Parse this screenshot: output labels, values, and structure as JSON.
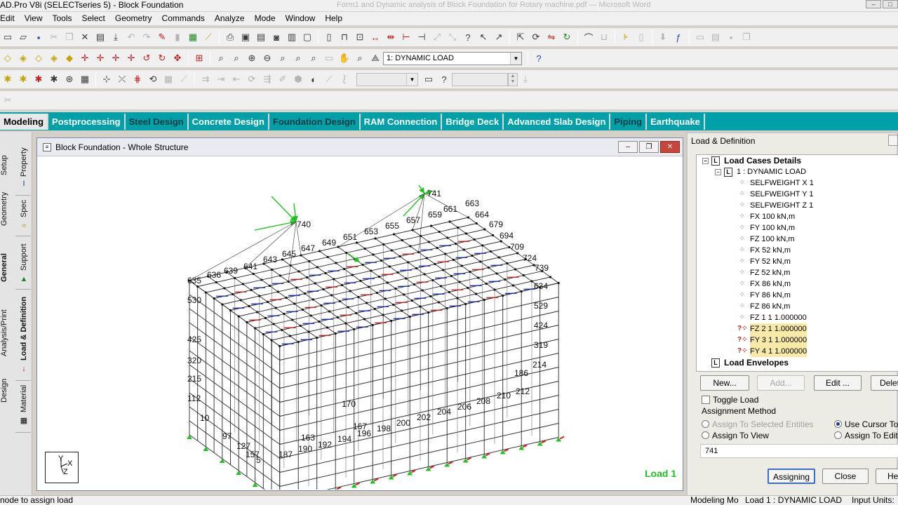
{
  "window": {
    "title": "AD.Pro V8i (SELECTseries 5) - Block Foundation",
    "ghost_title": "Form1 and Dynamic analysis of Block Foundation for Rotary machine.pdf — Microsoft Word"
  },
  "menu": [
    "Edit",
    "View",
    "Tools",
    "Select",
    "Geometry",
    "Commands",
    "Analyze",
    "Mode",
    "Window",
    "Help"
  ],
  "toolbar": {
    "load_case_value": "1: DYNAMIC LOAD"
  },
  "workflow_tabs": [
    {
      "label": "Modeling",
      "state": "active"
    },
    {
      "label": "Postprocessing",
      "state": "normal"
    },
    {
      "label": "Steel Design",
      "state": "dark"
    },
    {
      "label": "Concrete Design",
      "state": "normal"
    },
    {
      "label": "Foundation Design",
      "state": "dark"
    },
    {
      "label": "RAM Connection",
      "state": "normal"
    },
    {
      "label": "Bridge Deck",
      "state": "normal"
    },
    {
      "label": "Advanced Slab Design",
      "state": "normal"
    },
    {
      "label": "Piping",
      "state": "dark"
    },
    {
      "label": "Earthquake",
      "state": "normal"
    }
  ],
  "left_tabs": {
    "outer": [
      "Setup",
      "Geometry",
      "General",
      "Analysis/Print",
      "Design"
    ],
    "inner": [
      "Property",
      "Spec",
      "Support",
      "Load & Definition",
      "Material"
    ]
  },
  "viewport": {
    "title": "Block Foundation - Whole Structure",
    "load_label": "Load 1",
    "axis_labels": [
      "Y",
      "X",
      "Z"
    ],
    "node_labels": [
      {
        "t": "740"
      },
      {
        "t": "741"
      },
      {
        "t": "663"
      },
      {
        "t": "661"
      },
      {
        "t": "664"
      },
      {
        "t": "659"
      },
      {
        "t": "657"
      },
      {
        "t": "655"
      },
      {
        "t": "653"
      },
      {
        "t": "651"
      },
      {
        "t": "649"
      },
      {
        "t": "647"
      },
      {
        "t": "645"
      },
      {
        "t": "643"
      },
      {
        "t": "641"
      },
      {
        "t": "639"
      },
      {
        "t": "636"
      },
      {
        "t": "635"
      },
      {
        "t": "679"
      },
      {
        "t": "694"
      },
      {
        "t": "709"
      },
      {
        "t": "724"
      },
      {
        "t": "739"
      },
      {
        "t": "634"
      },
      {
        "t": "529"
      },
      {
        "t": "424"
      },
      {
        "t": "319"
      },
      {
        "t": "214"
      },
      {
        "t": "212"
      },
      {
        "t": "210"
      },
      {
        "t": "208"
      },
      {
        "t": "206"
      },
      {
        "t": "204"
      },
      {
        "t": "202"
      },
      {
        "t": "200"
      },
      {
        "t": "198"
      },
      {
        "t": "196"
      },
      {
        "t": "194"
      },
      {
        "t": "192"
      },
      {
        "t": "190"
      },
      {
        "t": "187"
      },
      {
        "t": "530"
      },
      {
        "t": "425"
      },
      {
        "t": "320"
      },
      {
        "t": "215"
      },
      {
        "t": "112"
      },
      {
        "t": "10"
      },
      {
        "t": "97"
      },
      {
        "t": "127"
      },
      {
        "t": "157"
      },
      {
        "t": "5"
      },
      {
        "t": "163"
      },
      {
        "t": "167"
      },
      {
        "t": "186"
      },
      {
        "t": "170"
      }
    ]
  },
  "panel": {
    "title": "Load & Definition",
    "tree": {
      "root": "Load Cases Details",
      "case": "1 : DYNAMIC LOAD",
      "items": [
        {
          "label": "SELFWEIGHT X 1",
          "kind": "ok"
        },
        {
          "label": "SELFWEIGHT Y 1",
          "kind": "ok"
        },
        {
          "label": "SELFWEIGHT Z 1",
          "kind": "ok"
        },
        {
          "label": "FX 100 kN,m",
          "kind": "ok"
        },
        {
          "label": "FY 100 kN,m",
          "kind": "ok"
        },
        {
          "label": "FZ 100 kN,m",
          "kind": "ok"
        },
        {
          "label": "FX 52 kN,m",
          "kind": "ok"
        },
        {
          "label": "FY 52 kN,m",
          "kind": "ok"
        },
        {
          "label": "FZ 52 kN,m",
          "kind": "ok"
        },
        {
          "label": "FX 86 kN,m",
          "kind": "ok"
        },
        {
          "label": "FY 86 kN,m",
          "kind": "ok"
        },
        {
          "label": "FZ 86 kN,m",
          "kind": "ok"
        },
        {
          "label": "FZ 1 1 1.000000",
          "kind": "ok"
        },
        {
          "label": "FZ 2 1 1.000000",
          "kind": "q"
        },
        {
          "label": "FY 3 1 1.000000",
          "kind": "q"
        },
        {
          "label": "FY 4 1 1.000000",
          "kind": "q"
        }
      ],
      "envelopes": "Load Envelopes"
    },
    "buttons": {
      "new": "New...",
      "add": "Add...",
      "edit": "Edit ...",
      "delete": "Delete"
    },
    "toggle_load": "Toggle Load",
    "assignment_method": "Assignment Method",
    "radios": {
      "selected": "Assign To Selected Entities",
      "cursor": "Use Cursor To Assign",
      "view": "Assign To View",
      "edit_list": "Assign To Edit List"
    },
    "edit_value": "741",
    "assigning": "Assigning",
    "close": "Close",
    "help": "Help"
  },
  "status": {
    "left": "node to assign load",
    "mode": "Modeling Mo",
    "load": "Load 1 : DYNAMIC LOAD",
    "units": "Input Units:"
  },
  "colors": {
    "tabbar": "#00a0a8",
    "load_text": "#22c022",
    "mesh": "#2a2a2a",
    "load_arrow": "#22c022"
  }
}
